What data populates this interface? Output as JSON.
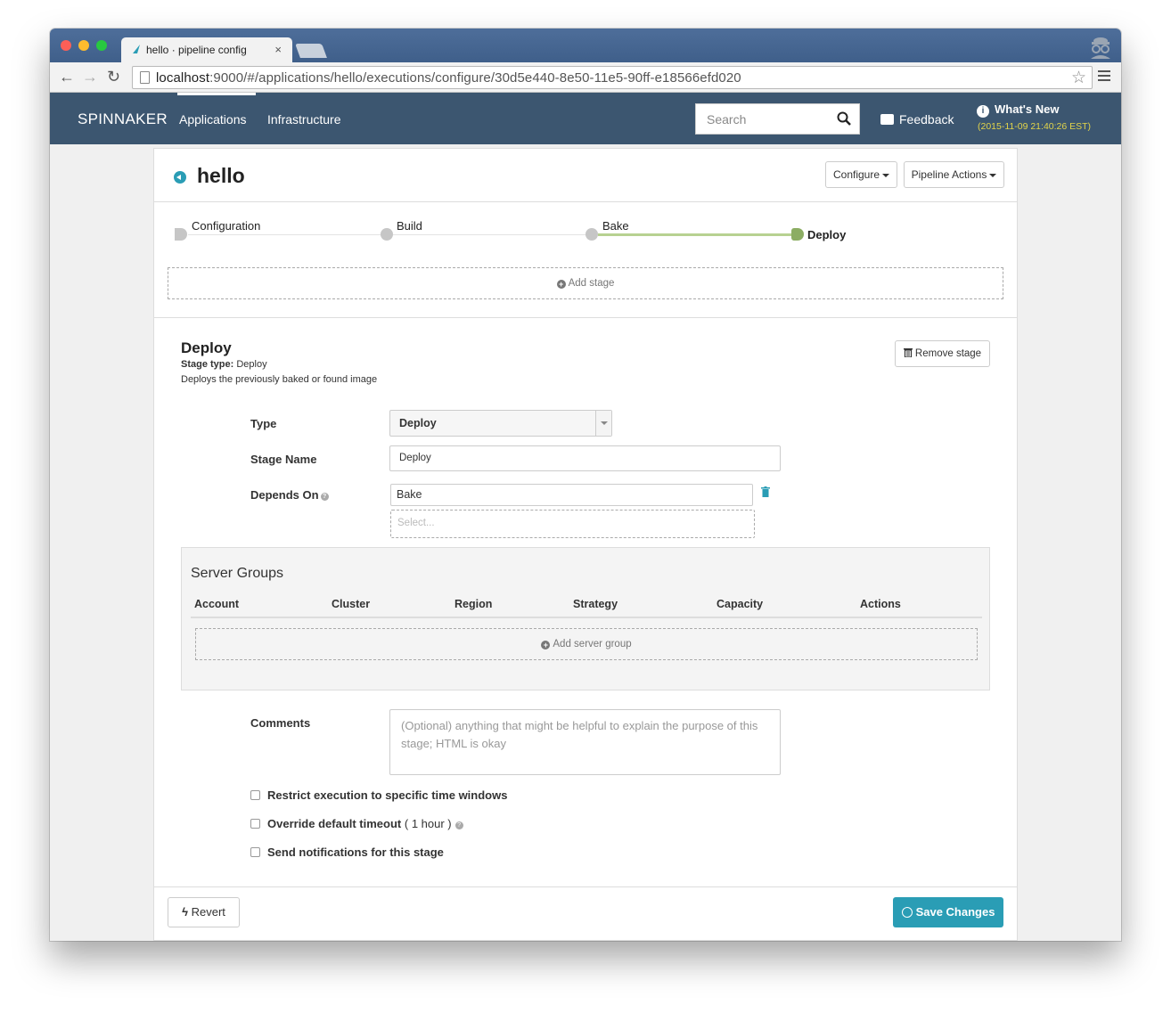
{
  "browser": {
    "tab_title": "hello · pipeline config",
    "tab_close": "×",
    "url_host": "localhost",
    "url_path": ":9000/#/applications/hello/executions/configure/30d5e440-8e50-11e5-90ff-e18566efd020"
  },
  "header": {
    "brand": "SPINNAKER",
    "nav": [
      "Applications",
      "Infrastructure"
    ],
    "search_placeholder": "Search",
    "feedback": "Feedback",
    "whats_new": "What's New",
    "whats_new_date": "(2015-11-09 21:40:26 EST)"
  },
  "app": {
    "title": "hello",
    "configure_label": "Configure",
    "pipeline_actions_label": "Pipeline Actions"
  },
  "pipeline": {
    "stages": [
      "Configuration",
      "Build",
      "Bake",
      "Deploy"
    ],
    "add_stage": "Add stage"
  },
  "stage": {
    "heading": "Deploy",
    "type_label": "Stage type:",
    "type_value": "Deploy",
    "description": "Deploys the previously baked or found image",
    "remove_label": "Remove stage",
    "fields": {
      "type_label": "Type",
      "type_value": "Deploy",
      "name_label": "Stage Name",
      "name_value": "Deploy",
      "depends_label": "Depends On",
      "depends_value": "Bake",
      "depends_placeholder": "Select..."
    }
  },
  "server_groups": {
    "title": "Server Groups",
    "columns": [
      "Account",
      "Cluster",
      "Region",
      "Strategy",
      "Capacity",
      "Actions"
    ],
    "add_label": "Add server group"
  },
  "comments": {
    "label": "Comments",
    "placeholder": "(Optional) anything that might be helpful to explain the purpose of this stage; HTML is okay"
  },
  "options": {
    "restrict": "Restrict execution to specific time windows",
    "override": "Override default timeout",
    "override_detail": "( 1 hour )",
    "notify": "Send notifications for this stage"
  },
  "footer": {
    "revert": "Revert",
    "save": "Save Changes"
  },
  "colors": {
    "header_bg": "#3c5670",
    "accent": "#2a9db5",
    "active_edge": "#b7d191",
    "active_node": "#8cad63",
    "date_text": "#e2d44a"
  }
}
